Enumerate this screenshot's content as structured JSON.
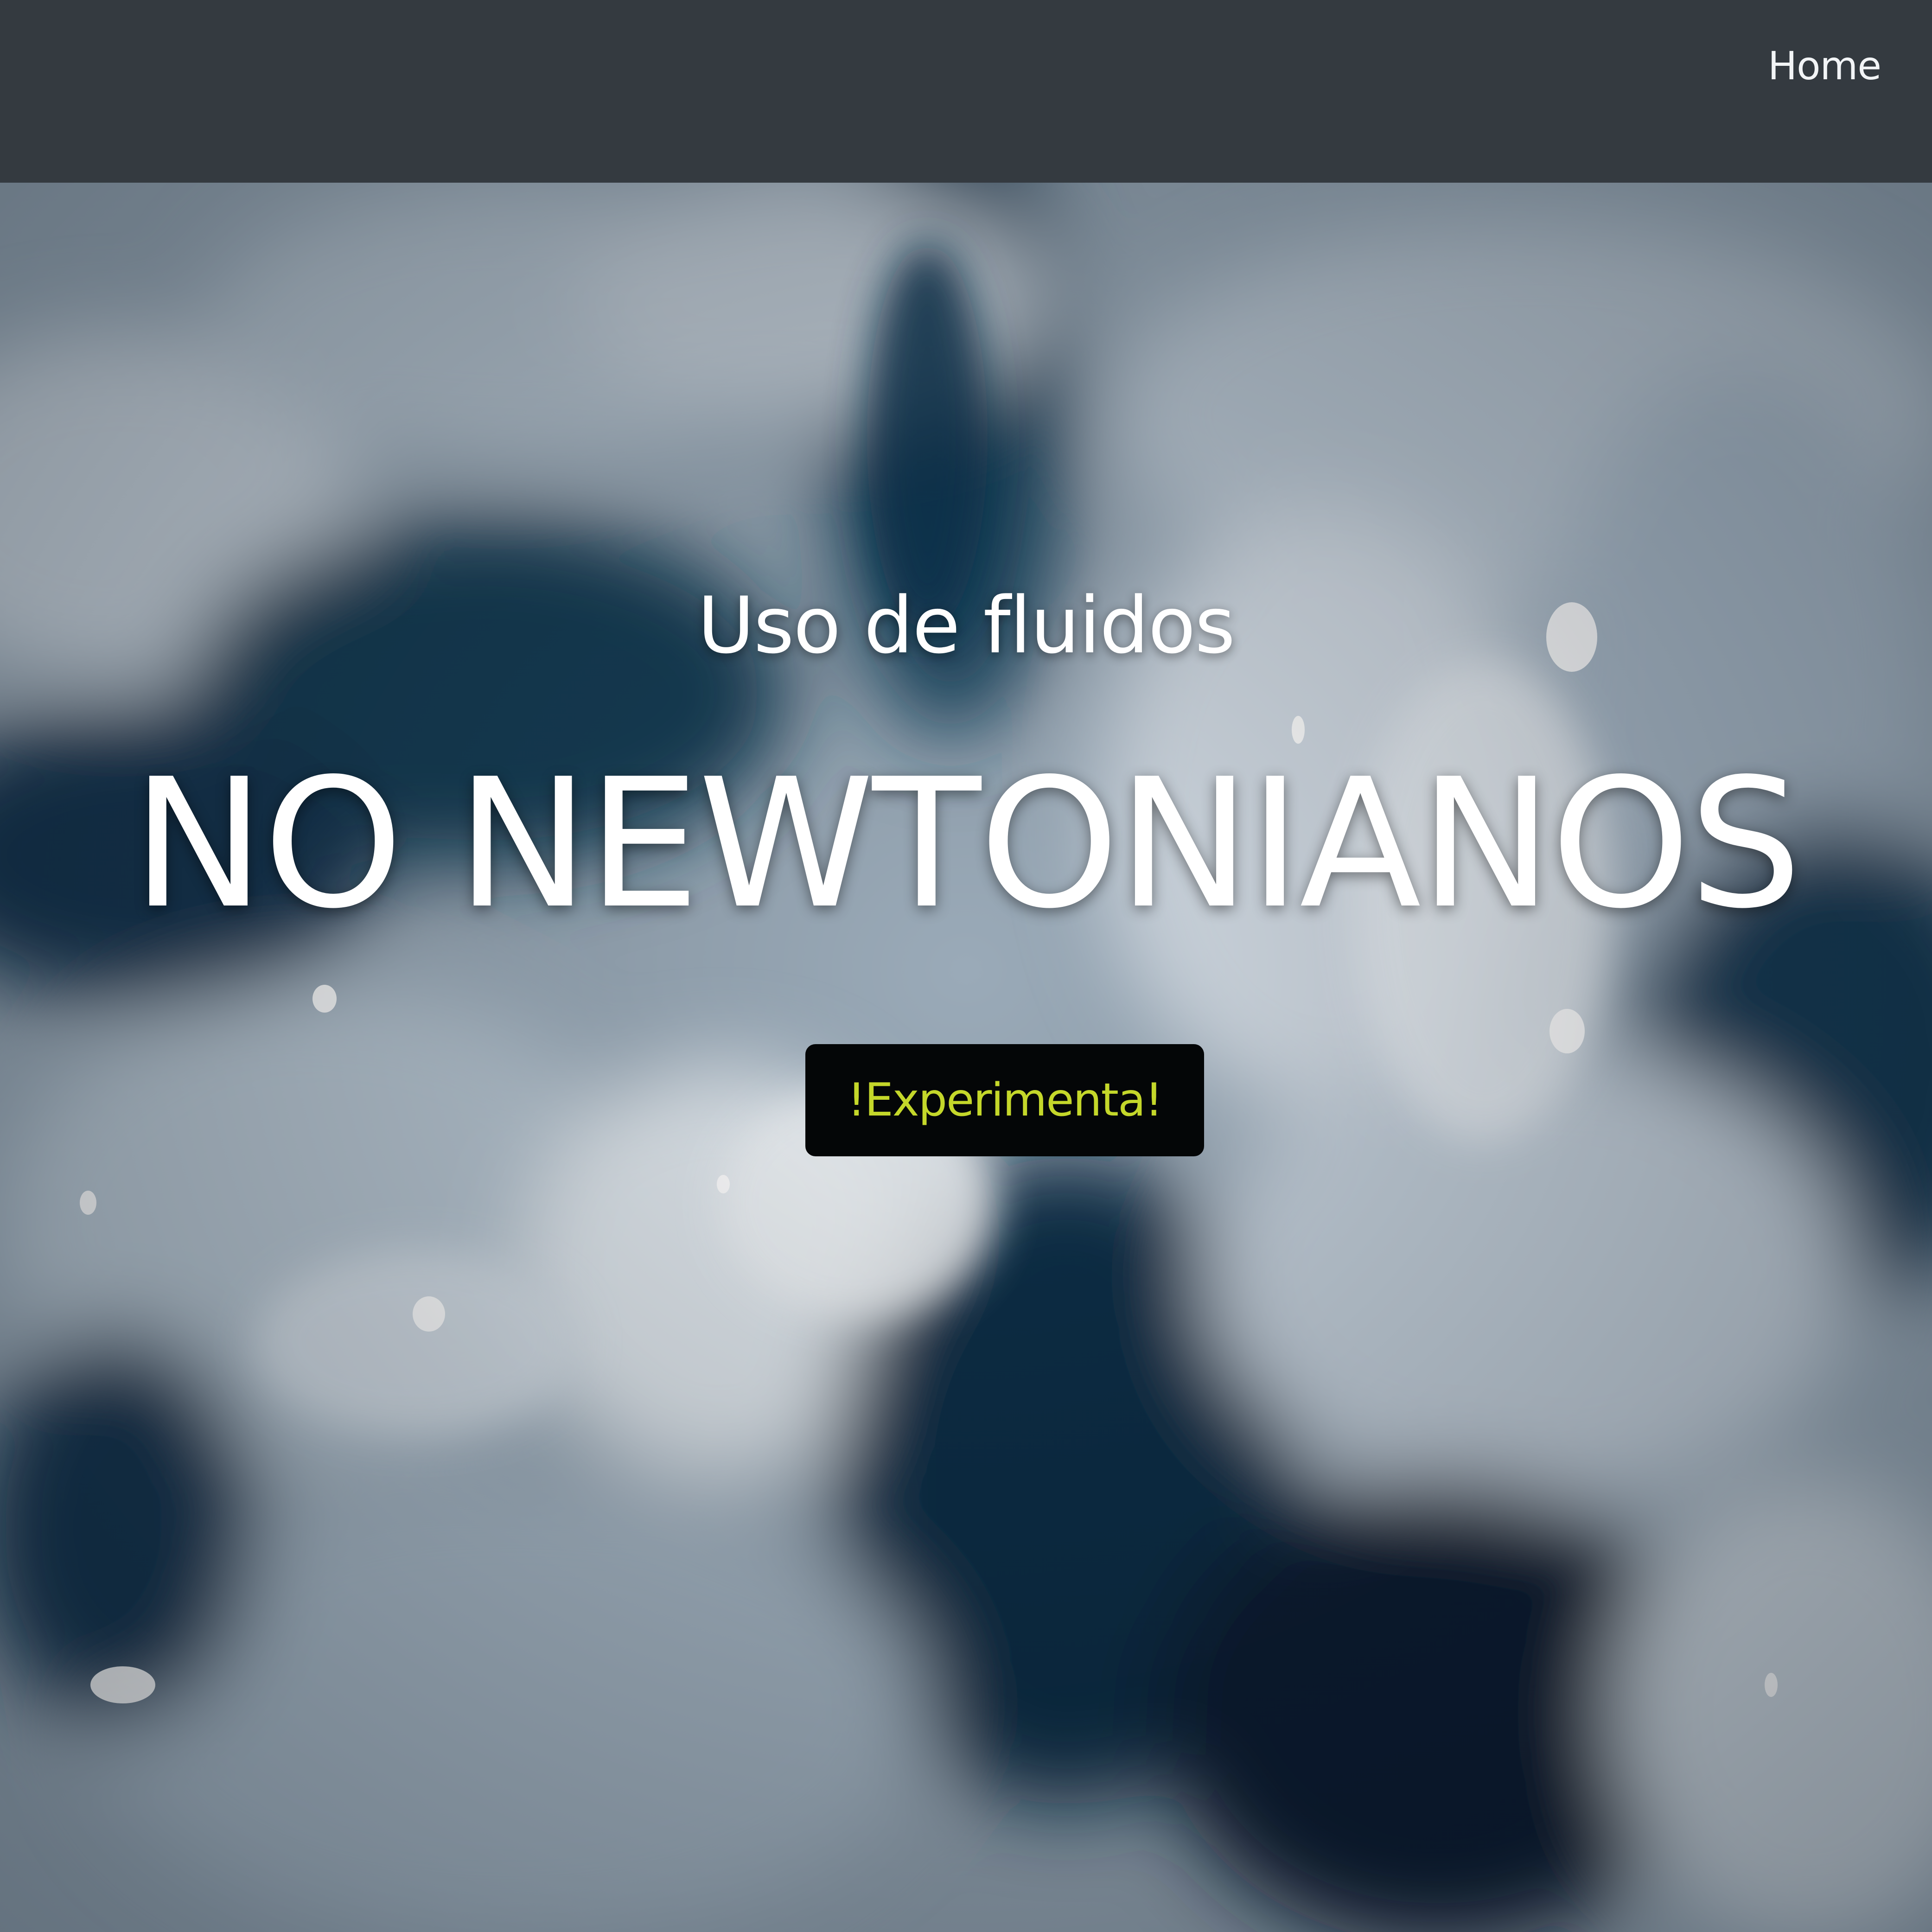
{
  "navbar": {
    "links": [
      {
        "label": "Home"
      }
    ]
  },
  "hero": {
    "subtitle": "Uso de fluidos",
    "title": "NO NEWTONIANOS",
    "cta_label": "!Experimenta!",
    "background": "blurred-non-newtonian-fluid-photo"
  },
  "colors": {
    "navbar_bg": "#343a40",
    "nav_text": "#f2f4f6",
    "hero_text": "#ffffff",
    "button_bg": "#040607",
    "button_text": "#c4d72a"
  }
}
